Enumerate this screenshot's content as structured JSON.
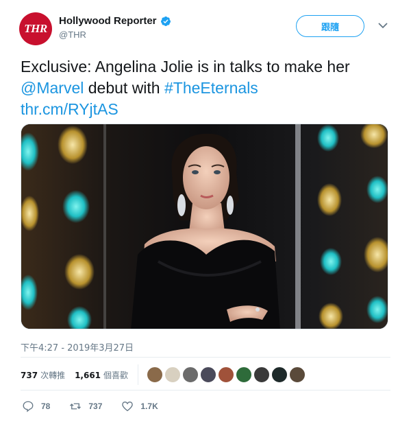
{
  "account": {
    "avatar_text": "THR",
    "display_name": "Hollywood Reporter",
    "handle": "@THR",
    "follow_label": "跟隨"
  },
  "tweet": {
    "text_part1": "Exclusive: Angelina Jolie is in talks to make her ",
    "mention": "@Marvel",
    "text_part2": " debut with ",
    "hashtag": "#TheEternals",
    "link": "thr.cm/RYjtAS",
    "timestamp": "下午4:27 - 2019年3月27日"
  },
  "stats": {
    "retweets_count": "737",
    "retweets_label": "次轉推",
    "likes_count": "1,661",
    "likes_label": "個喜歡"
  },
  "likers": [
    {
      "name": "liker-avatar-1",
      "color": "#8a6a4a"
    },
    {
      "name": "liker-avatar-2",
      "color": "#d8d0c0"
    },
    {
      "name": "liker-avatar-3",
      "color": "#6b6b6b"
    },
    {
      "name": "liker-avatar-4",
      "color": "#4a4a5a"
    },
    {
      "name": "liker-avatar-5",
      "color": "#a0523a"
    },
    {
      "name": "liker-avatar-6",
      "color": "#2e6b3a"
    },
    {
      "name": "liker-avatar-7",
      "color": "#3a3a3a"
    },
    {
      "name": "liker-avatar-8",
      "color": "#1e2a2a"
    },
    {
      "name": "liker-avatar-9",
      "color": "#5a4a3a"
    }
  ],
  "actions": {
    "reply_count": "78",
    "retweet_count": "737",
    "like_count": "1.7K"
  },
  "colors": {
    "link": "#1b95e0",
    "brand": "#1da1f2",
    "avatar_bg": "#c8102e",
    "muted": "#657786"
  },
  "icons": {
    "verified": "verified-badge-icon",
    "caret": "chevron-down-icon",
    "reply": "reply-icon",
    "retweet": "retweet-icon",
    "like": "heart-icon"
  }
}
